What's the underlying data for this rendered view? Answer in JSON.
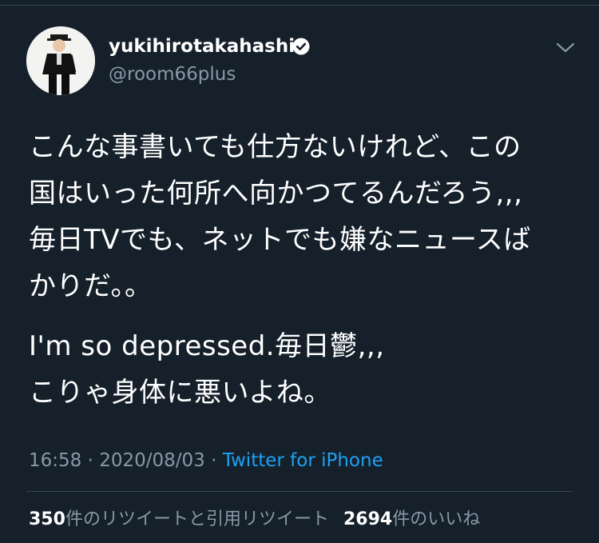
{
  "user": {
    "display_name": "yukihirotakahashi",
    "handle": "@room66plus",
    "verified_icon": "verified-badge-icon",
    "avatar_icon": "profile-photo"
  },
  "tweet": {
    "paragraph1": [
      "こんな事書いても仕方ないけれど、この",
      "国はいった何所へ向かつてるんだろう,,,",
      "毎日TVでも、ネットでも嫌なニュースば",
      "かりだ。。"
    ],
    "paragraph2": [
      "I'm so depressed.毎日鬱,,,",
      "こりゃ身体に悪いよね。"
    ]
  },
  "meta": {
    "time": "16:58",
    "separator": "·",
    "date": "2020/08/03",
    "source": "Twitter for iPhone"
  },
  "stats": {
    "retweets_count": "350",
    "retweets_label": "件のリツイートと引用リツイート",
    "likes_count": "2694",
    "likes_label": "件のいいね"
  },
  "colors": {
    "background": "#15202b",
    "text_primary": "#ffffff",
    "text_secondary": "#8899a6",
    "accent": "#1da1f2",
    "divider": "#38444d"
  }
}
